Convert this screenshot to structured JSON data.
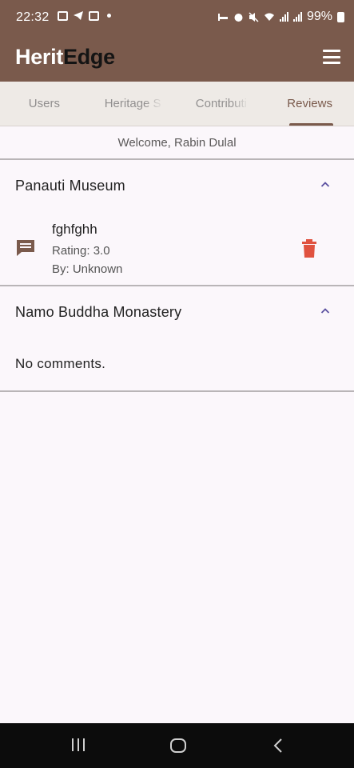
{
  "status": {
    "time": "22:32",
    "battery": "99%"
  },
  "app": {
    "brand_part1": "Herit",
    "brand_part2": "Edge"
  },
  "tabs": [
    {
      "label": "Users",
      "active": false
    },
    {
      "label": "Heritage S",
      "active": false
    },
    {
      "label": "Contributi",
      "active": false
    },
    {
      "label": "Reviews",
      "active": true
    }
  ],
  "welcome": "Welcome, Rabin Dulal",
  "sections": [
    {
      "title": "Panauti Museum",
      "expanded": true,
      "comments": [
        {
          "text": "fghfghh",
          "rating": "Rating: 3.0",
          "by": "By: Unknown"
        }
      ]
    },
    {
      "title": "Namo Buddha Monastery",
      "expanded": true,
      "empty_text": "No comments."
    }
  ],
  "colors": {
    "brand": "#7a5a4c",
    "delete": "#e0523f",
    "chevron": "#5a4fa0"
  },
  "icons": [
    "menu-icon",
    "chevron-up-icon",
    "comment-icon",
    "delete-icon",
    "recents-icon",
    "home-icon",
    "back-icon"
  ]
}
